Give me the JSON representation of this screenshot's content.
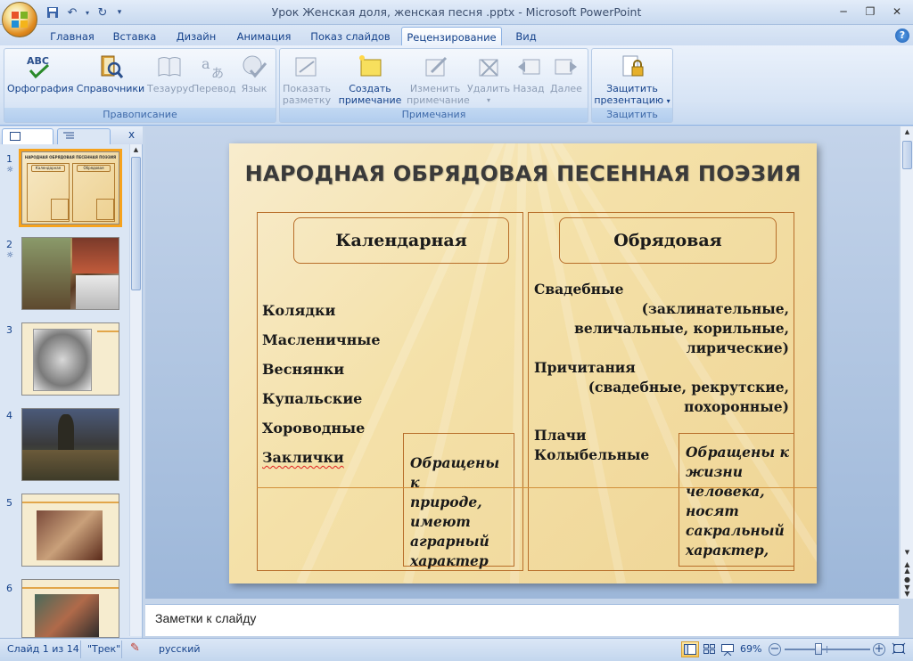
{
  "window": {
    "title": "Урок Женская доля, женская песня .pptx - Microsoft PowerPoint"
  },
  "tabs": [
    "Главная",
    "Вставка",
    "Дизайн",
    "Анимация",
    "Показ слайдов",
    "Рецензирование",
    "Вид"
  ],
  "active_tab": "Рецензирование",
  "ribbon": {
    "proofing": {
      "label": "Правописание",
      "abc": "ABC",
      "spelling": "Орфография",
      "research": "Справочники",
      "thesaurus": "Тезаурус",
      "translate": "Перевод",
      "language": "Язык"
    },
    "comments": {
      "label": "Примечания",
      "show_markup_1": "Показать",
      "show_markup_2": "разметку",
      "new_comment_1": "Создать",
      "new_comment_2": "примечание",
      "edit_comment_1": "Изменить",
      "edit_comment_2": "примечание",
      "delete": "Удалить",
      "previous": "Назад",
      "next": "Далее"
    },
    "protect": {
      "label": "Защитить",
      "protect_1": "Защитить",
      "protect_2": "презентацию"
    }
  },
  "slides_pane": {
    "close": "x",
    "items": [
      {
        "num": "1",
        "title": "НАРОДНАЯ ОБРЯДОВАЯ ПЕСЕННАЯ ПОЭЗИЯ",
        "col1": "Календарная",
        "col2": "Обрядовая"
      },
      {
        "num": "2"
      },
      {
        "num": "3"
      },
      {
        "num": "4"
      },
      {
        "num": "5"
      },
      {
        "num": "6"
      }
    ]
  },
  "slide": {
    "title": "НАРОДНАЯ ОБРЯДОВАЯ ПЕСЕННАЯ ПОЭЗИЯ",
    "left": {
      "header": "Календарная",
      "items": [
        "Колядки",
        "Масленичные",
        "Веснянки",
        "Купальские",
        "Хороводные",
        "Заклички"
      ],
      "note": [
        "Обращены к",
        "природе,",
        "имеют",
        "аграрный",
        "характер"
      ]
    },
    "right": {
      "header": "Обрядовая",
      "l1": "Свадебные",
      "l2": "(заклинательные,",
      "l3": "величальные, корильные,",
      "l4": "лирические)",
      "l5": "Причитания",
      "l6": "(свадебные, рекрутские,",
      "l7": "похоронные)",
      "l8": "Плачи",
      "l9": "Колыбельные",
      "note": [
        "Обращены к",
        "жизни",
        "человека,",
        "носят",
        "сакральный",
        "характер,"
      ]
    }
  },
  "notes": {
    "placeholder": "Заметки к слайду"
  },
  "status": {
    "slide_info": "Слайд 1 из 14",
    "theme": "\"Трек\"",
    "language": "русский",
    "zoom": "69%",
    "zoom_fraction": 0.4
  }
}
